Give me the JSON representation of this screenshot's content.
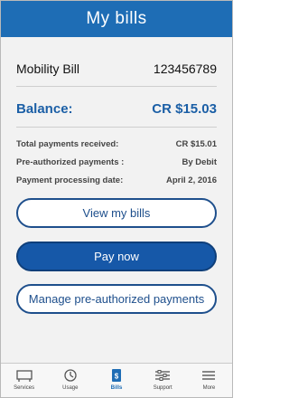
{
  "header": {
    "title": "My bills"
  },
  "bill": {
    "name": "Mobility Bill",
    "number": "123456789"
  },
  "balance": {
    "label": "Balance:",
    "value": "CR $15.03"
  },
  "details": [
    {
      "label": "Total payments received:",
      "value": "CR $15.01"
    },
    {
      "label": "Pre-authorized payments :",
      "value": "By Debit"
    },
    {
      "label": "Payment processing date:",
      "value": "April 2, 2016"
    }
  ],
  "buttons": {
    "view_bills": "View my bills",
    "pay_now": "Pay now",
    "manage_preauth": "Manage pre-authorized payments"
  },
  "tabs": [
    {
      "label": "Services",
      "icon": "services-icon"
    },
    {
      "label": "Usage",
      "icon": "usage-icon"
    },
    {
      "label": "Bills",
      "icon": "bills-icon",
      "active": true
    },
    {
      "label": "Support",
      "icon": "support-icon"
    },
    {
      "label": "More",
      "icon": "more-icon"
    }
  ],
  "colors": {
    "brand_blue": "#1e6db5",
    "button_blue": "#1658a8",
    "balance_blue": "#1b5fa6"
  }
}
